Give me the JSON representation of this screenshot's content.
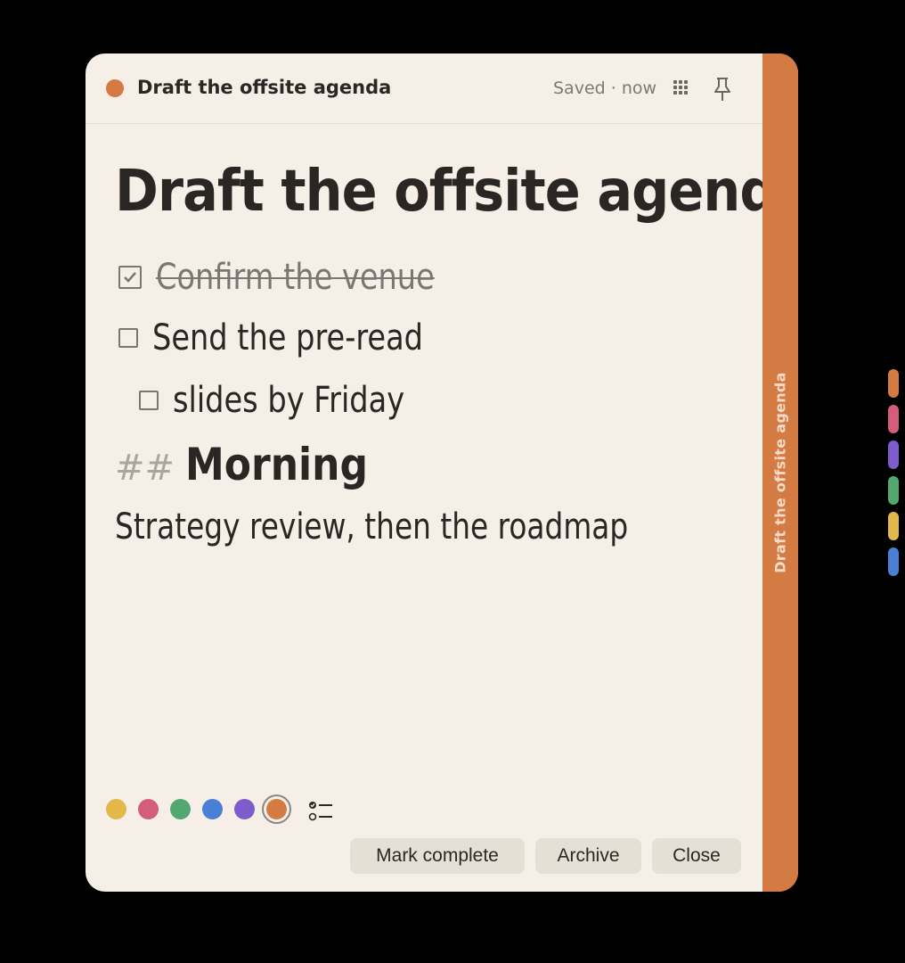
{
  "header": {
    "title": "Draft the offsite agenda",
    "status": "Saved · now",
    "grid_icon": "grid-icon",
    "pin_icon": "pin-icon"
  },
  "note": {
    "title": "Draft the offsite agenda",
    "checklist": [
      {
        "text": "Confirm the venue",
        "checked": true
      },
      {
        "text": "Send the pre-read",
        "checked": false
      },
      {
        "text": "slides by Friday",
        "checked": false
      }
    ],
    "heading_marker": "##",
    "heading": "Morning",
    "paragraph": "Strategy review, then the roadmap"
  },
  "side_tab": {
    "label": "Draft the offsite agenda",
    "color": "#d47a43"
  },
  "colors": [
    {
      "name": "yellow",
      "hex": "#e2b84a"
    },
    {
      "name": "pink",
      "hex": "#d55d7c"
    },
    {
      "name": "green",
      "hex": "#52a870"
    },
    {
      "name": "blue",
      "hex": "#4a7fd6"
    },
    {
      "name": "purple",
      "hex": "#7e5ccc"
    },
    {
      "name": "orange",
      "hex": "#d47a43",
      "selected": true
    }
  ],
  "actions": {
    "mark_complete": "Mark complete",
    "archive": "Archive",
    "close": "Close"
  },
  "rail_tabs": [
    "#d47a43",
    "#d55d7c",
    "#7e5ccc",
    "#52a870",
    "#e2b84a",
    "#4a7fd6"
  ]
}
